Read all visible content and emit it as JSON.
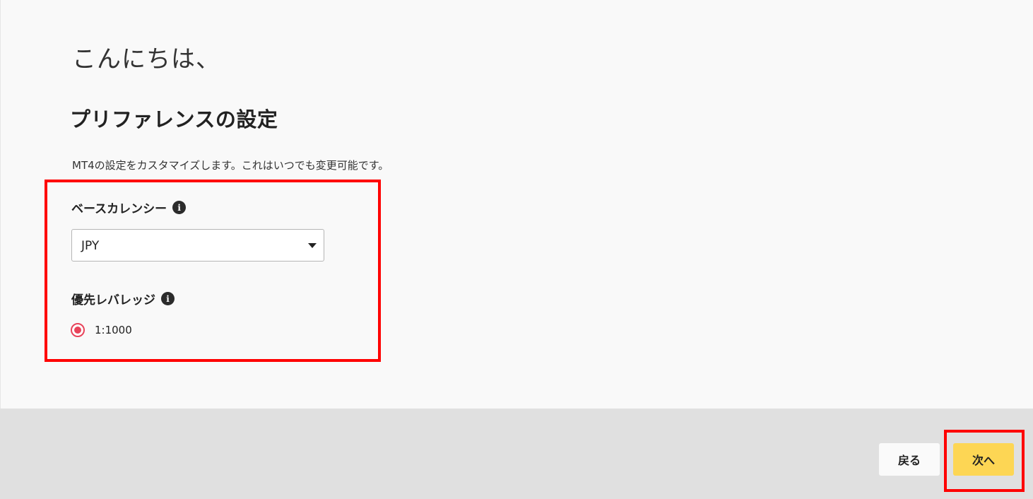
{
  "greeting": "こんにちは、",
  "title": "プリファレンスの設定",
  "description": "MT4の設定をカスタマイズします。これはいつでも変更可能です。",
  "base_currency": {
    "label": "ベースカレンシー",
    "info_icon": "info-icon",
    "selected_value": "JPY"
  },
  "leverage": {
    "label": "優先レバレッジ",
    "info_icon": "info-icon",
    "options": [
      {
        "label": "1:1000",
        "selected": true
      }
    ]
  },
  "footer": {
    "back_label": "戻る",
    "next_label": "次へ"
  },
  "colors": {
    "accent_radio": "#e8435a",
    "next_button": "#fdd654",
    "highlight_annotation": "#ff0000"
  }
}
